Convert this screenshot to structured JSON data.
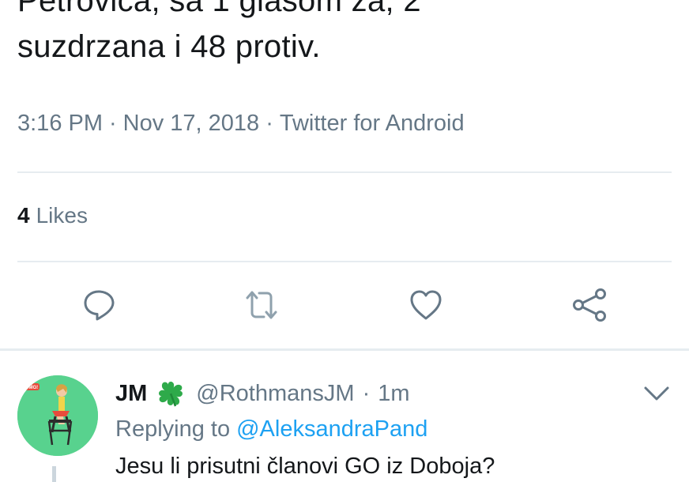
{
  "tweet": {
    "text_lines": [
      "Petrovića, sa 1 glasom za, 2",
      "suzdrzana i 48 protiv."
    ],
    "time": "3:16 PM",
    "date": "Nov 17, 2018",
    "source": "Twitter for Android",
    "separator": "·",
    "likes_count": "4",
    "likes_label": "Likes"
  },
  "actions": [
    {
      "icon": "reply-icon"
    },
    {
      "icon": "retweet-icon"
    },
    {
      "icon": "like-icon"
    },
    {
      "icon": "share-icon"
    }
  ],
  "reply": {
    "name": "JM",
    "name_emoji": "four-leaf-clover-icon",
    "handle": "@RothmansJM",
    "separator": "·",
    "time": "1m",
    "replying_label": "Replying to",
    "replying_to": "@AleksandraPand",
    "text": "Jesu li prisutni članovi GO iz Doboja?",
    "avatar_badge": "OMG!"
  },
  "colors": {
    "text": "#14171a",
    "secondary": "#657786",
    "link": "#1da1f2",
    "divider": "#e6ecf0",
    "avatar_bg": "#58d28e",
    "clover": "#2eaa4a"
  }
}
